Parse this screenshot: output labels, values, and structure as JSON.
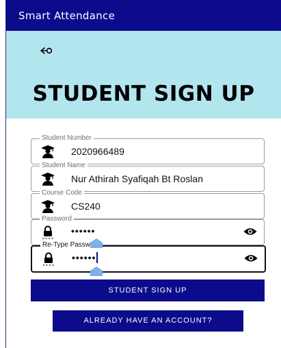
{
  "app": {
    "title": "Smart Attendance"
  },
  "hero": {
    "title": "STUDENT SIGN UP"
  },
  "form": {
    "student_number": {
      "label": "Student Number",
      "value": "2020966489",
      "icon": "graduate-icon"
    },
    "student_name": {
      "label": "Student Name",
      "value": "Nur Athirah Syafiqah Bt Roslan",
      "icon": "graduate-icon"
    },
    "course_code": {
      "label": "Course Code",
      "value": "CS240",
      "icon": "graduate-icon"
    },
    "password": {
      "label": "Password",
      "value": "••••••",
      "icon": "lock-icon"
    },
    "retype_password": {
      "label": "Re-Type Password",
      "value": "••••••",
      "icon": "lock-icon"
    }
  },
  "buttons": {
    "sign_up": "STUDENT SIGN UP",
    "have_account": "ALREADY HAVE AN ACCOUNT?"
  },
  "colors": {
    "primary": "#0b0b8c",
    "hero_bg": "#b3e5ef",
    "handle": "#7fb0e6"
  }
}
